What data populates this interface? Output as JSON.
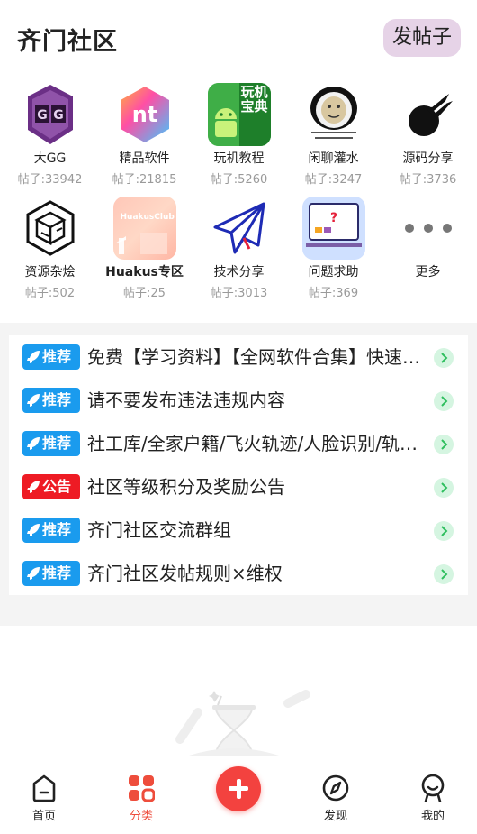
{
  "header": {
    "title": "齐门社区",
    "post_button": "发帖子"
  },
  "categories": [
    {
      "name": "大GG",
      "count": "帖子:33942",
      "icon": "gg-shield-icon"
    },
    {
      "name": "精品软件",
      "count": "帖子:21815",
      "icon": "nt-hexagon-icon"
    },
    {
      "name": "玩机教程",
      "count": "帖子:5260",
      "icon": "android-icon",
      "icon_text": "玩机宝典"
    },
    {
      "name": "闲聊灌水",
      "count": "帖子:3247",
      "icon": "panda-meme-icon"
    },
    {
      "name": "源码分享",
      "count": "帖子:3736",
      "icon": "comet-icon"
    },
    {
      "name": "资源杂烩",
      "count": "帖子:502",
      "icon": "cube-logo-icon"
    },
    {
      "name": "Huakus专区",
      "count": "帖子:25",
      "icon": "huakus-icon",
      "icon_text": "HuakusClub"
    },
    {
      "name": "技术分享",
      "count": "帖子:3013",
      "icon": "paper-plane-icon"
    },
    {
      "name": "问题求助",
      "count": "帖子:369",
      "icon": "question-board-icon"
    },
    {
      "name": "更多",
      "count": "",
      "icon": "more-dots-icon"
    }
  ],
  "notices": [
    {
      "tag": "推荐",
      "tag_color": "#1a9bee",
      "text": "免费【学习资料】【全网软件合集】快速获取"
    },
    {
      "tag": "推荐",
      "tag_color": "#1a9bee",
      "text": "请不要发布违法违规内容"
    },
    {
      "tag": "推荐",
      "tag_color": "#1a9bee",
      "text": "社工库/全家户籍/飞火轨迹/人脸识别/轨迹查询"
    },
    {
      "tag": "公告",
      "tag_color": "#ee1b24",
      "text": "社区等级积分及奖励公告"
    },
    {
      "tag": "推荐",
      "tag_color": "#1a9bee",
      "text": "齐门社区交流群组"
    },
    {
      "tag": "推荐",
      "tag_color": "#1a9bee",
      "text": "齐门社区发帖规则×维权"
    }
  ],
  "tabs": [
    {
      "label": "首页",
      "icon": "home-icon",
      "active": false
    },
    {
      "label": "分类",
      "icon": "category-icon",
      "active": true
    },
    {
      "label": "",
      "icon": "plus-icon",
      "active": false
    },
    {
      "label": "发现",
      "icon": "compass-icon",
      "active": false
    },
    {
      "label": "我的",
      "icon": "profile-icon",
      "active": false
    }
  ],
  "colors": {
    "accent": "#ee4d3c",
    "post_button_bg": "#e6d3e7",
    "recommend": "#1a9bee",
    "announce": "#ee1b24"
  }
}
